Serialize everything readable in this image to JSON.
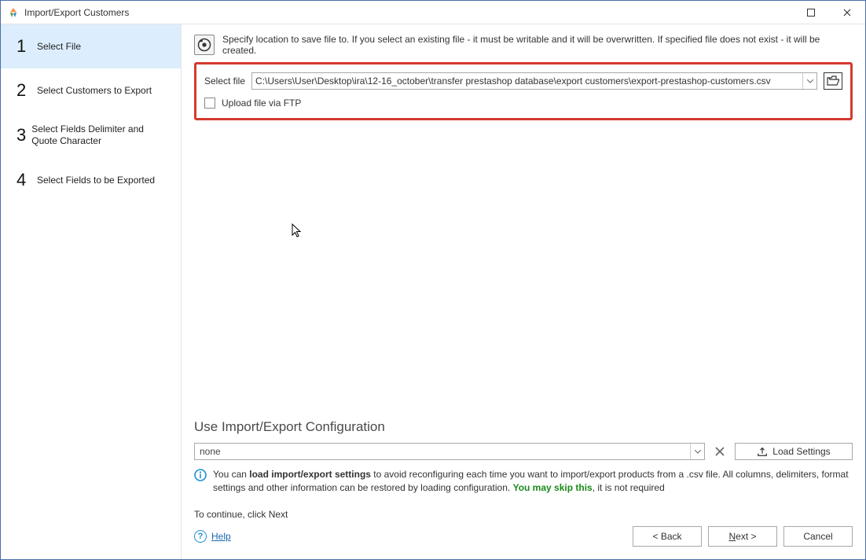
{
  "window": {
    "title": "Import/Export Customers"
  },
  "sidebar": {
    "steps": [
      {
        "num": "1",
        "label": "Select File",
        "active": true
      },
      {
        "num": "2",
        "label": "Select Customers to Export",
        "active": false
      },
      {
        "num": "3",
        "label": "Select Fields Delimiter and Quote Character",
        "active": false
      },
      {
        "num": "4",
        "label": "Select Fields to be Exported",
        "active": false
      }
    ]
  },
  "instruction": "Specify location to save file to. If you select an existing file - it must be writable and it will be overwritten. If specified file does not exist - it will be created.",
  "file": {
    "label": "Select file",
    "path": "C:\\Users\\User\\Desktop\\ira\\12-16_october\\transfer prestashop database\\export customers\\export-prestashop-customers.csv",
    "ftp_label": "Upload file via FTP",
    "ftp_checked": false
  },
  "config": {
    "heading": "Use Import/Export Configuration",
    "selected": "none",
    "load_label": "Load Settings",
    "info_prefix": "You can ",
    "info_bold": "load import/export settings",
    "info_mid": " to avoid reconfiguring each time you want to import/export products from a .csv file. All columns, delimiters, format settings and other information can be restored by loading configuration. ",
    "info_green": "You may skip this",
    "info_suffix": ", it is not required"
  },
  "continue_hint": "To continue, click Next",
  "footer": {
    "help": "Help",
    "back": "< Back",
    "next": "Next >",
    "cancel": "Cancel"
  }
}
